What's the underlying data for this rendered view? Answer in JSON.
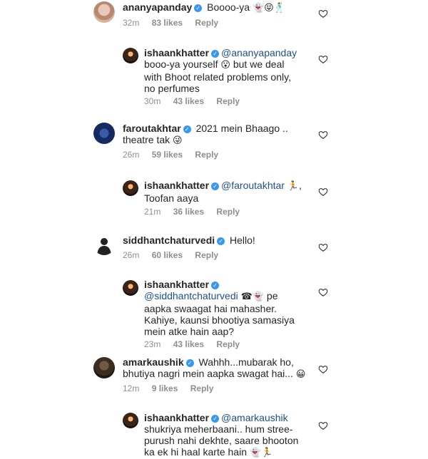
{
  "comments": [
    {
      "username": "ananyapanday",
      "text": "Boooo-ya",
      "emojis": "👻😝🕺",
      "time": "32m",
      "likes": "83 likes",
      "reply": "Reply"
    },
    {
      "username": "ishaankhatter",
      "mention": "@ananyapanday",
      "text": "booo-ya yourself",
      "emoji": "😮",
      "text2": "but we deal",
      "line2": "with Bhoot related problems only,",
      "line3": "no perfumes",
      "time": "30m",
      "likes": "43 likes",
      "reply": "Reply"
    },
    {
      "username": "faroutakhtar",
      "text": "2021 mein Bhaago ..",
      "line2": "theatre tak",
      "emoji": "😜",
      "time": "26m",
      "likes": "59 likes",
      "reply": "Reply"
    },
    {
      "username": "ishaankhatter",
      "mention": "@faroutakhtar",
      "emoji": "🏃",
      "line2": "Toofan aaya",
      "time": "21m",
      "likes": "36 likes",
      "reply": "Reply"
    },
    {
      "username": "siddhantchaturvedi",
      "text": "Hello!",
      "time": "26m",
      "likes": "60 likes",
      "reply": "Reply"
    },
    {
      "username": "ishaankhatter",
      "mention": "@siddhantchaturvedi",
      "emojis": "☎👻",
      "text": "pe",
      "line2": "aapka swaagat hai mahasher.",
      "line3": "Kahiye, kaunsi bhootiya samasiya",
      "line4": "mein atke hain aap?",
      "time": "23m",
      "likes": "43 likes",
      "reply": "Reply"
    },
    {
      "username": "amarkaushik",
      "text": "Wahhh...mubarak ho,",
      "line2": "bhutiya nagri mein aapka swagat hai...",
      "emoji": "😀",
      "time": "12m",
      "likes": "9 likes",
      "reply": "Reply"
    },
    {
      "username": "ishaankhatter",
      "mention": "@amarkaushik",
      "line2": "shukriya meherbaani.. hum stree-",
      "line3": "purush nahi dekhte, saare bhooton",
      "line4": "ka ek hi haal karte hain",
      "emojis": "👻🏃"
    }
  ],
  "icons": {
    "like": "heart-outline-icon",
    "verified": "verified-badge-icon"
  },
  "colors": {
    "verified": "#3897f0",
    "meta": "#8e8e8e",
    "text": "#262626"
  }
}
